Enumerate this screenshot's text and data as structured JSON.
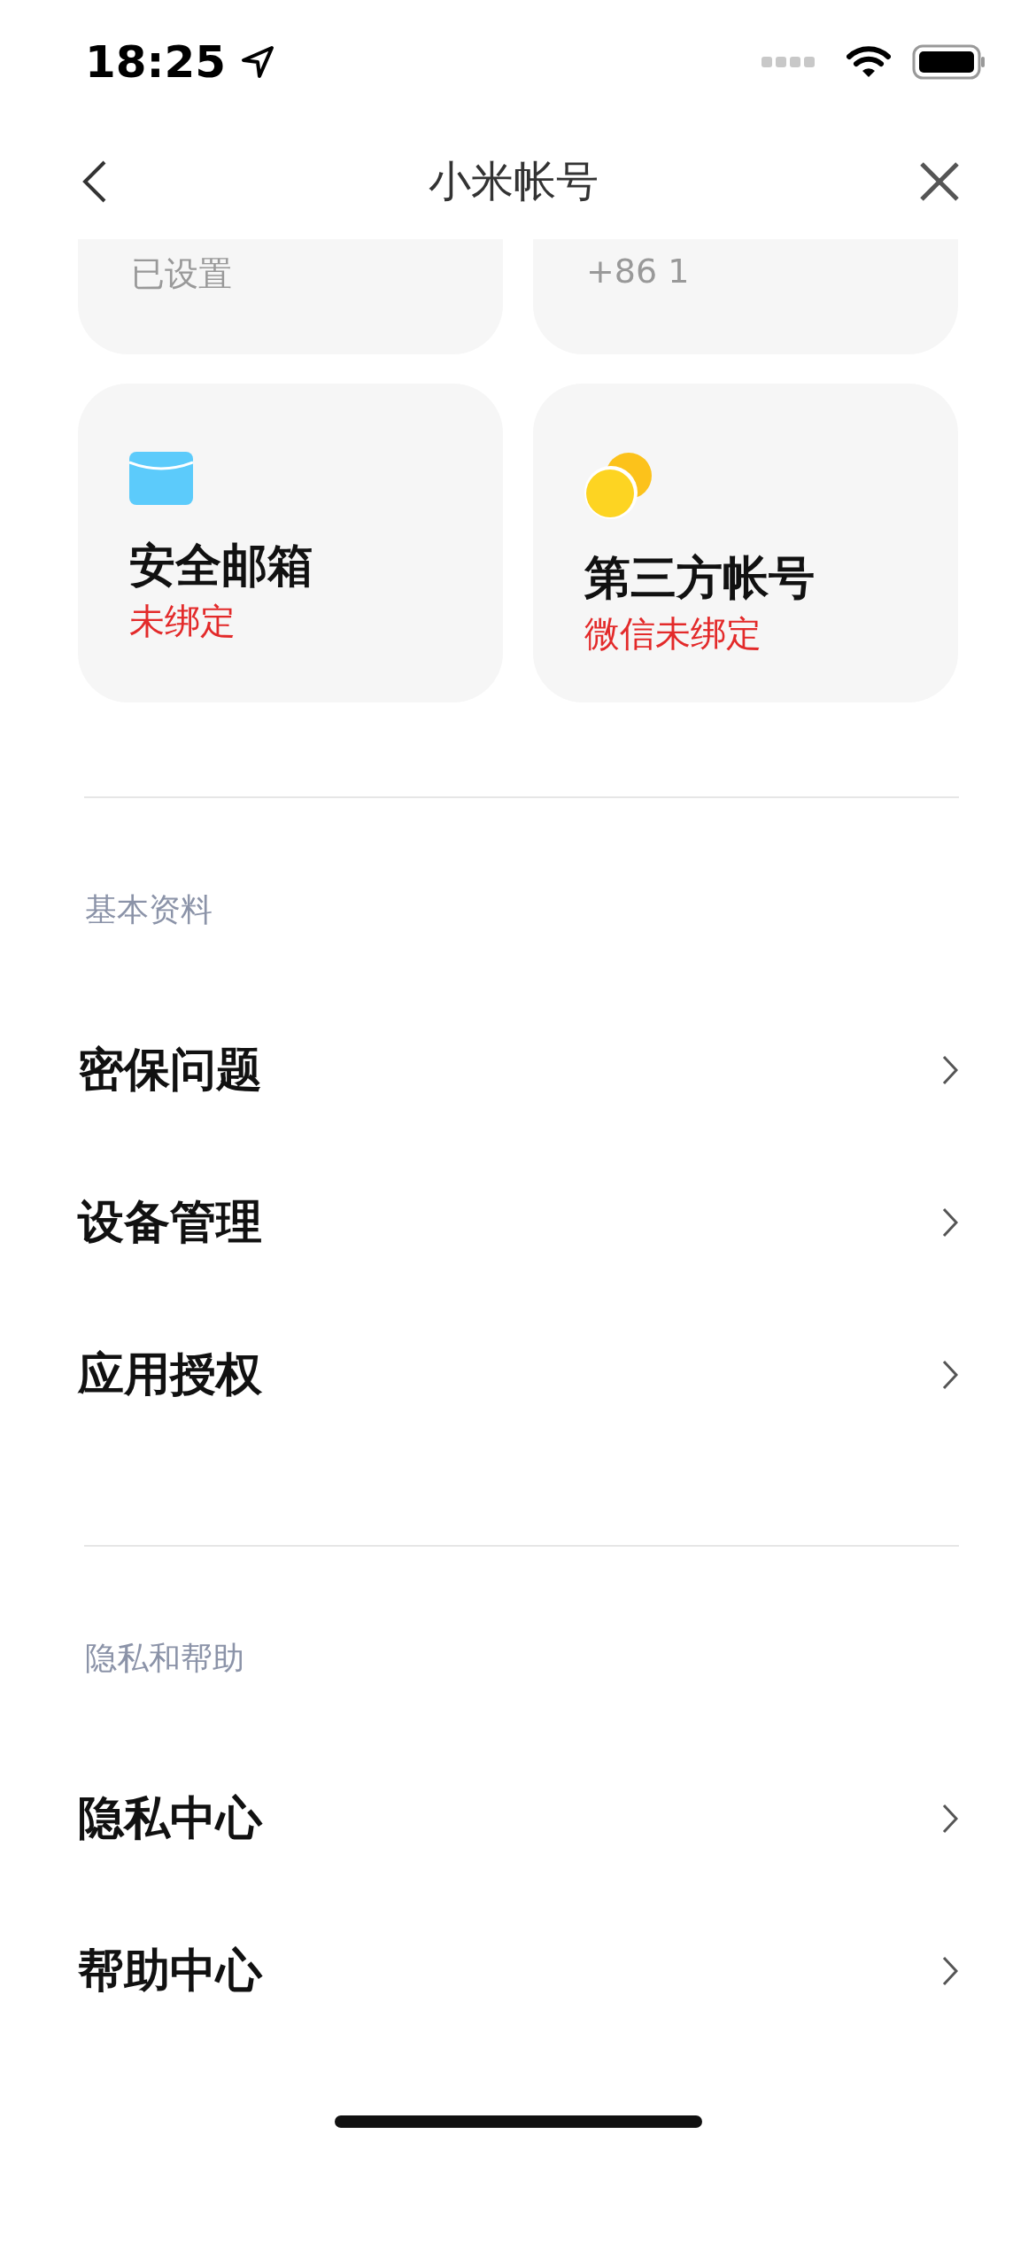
{
  "status_bar": {
    "time": "18:25"
  },
  "nav": {
    "title": "小米帐号"
  },
  "cards": [
    {
      "kind": "partial",
      "subtitle": "已设置",
      "warning": false
    },
    {
      "kind": "partial",
      "subtitle": "+86 1",
      "warning": false
    },
    {
      "kind": "mail",
      "title": "安全邮箱",
      "subtitle": "未绑定",
      "warning": true
    },
    {
      "kind": "coins",
      "title": "第三方帐号",
      "subtitle": "微信未绑定",
      "warning": true
    }
  ],
  "sections": [
    {
      "header": "基本资料",
      "items": [
        {
          "label": "密保问题"
        },
        {
          "label": "设备管理"
        },
        {
          "label": "应用授权"
        }
      ]
    },
    {
      "header": "隐私和帮助",
      "items": [
        {
          "label": "隐私中心"
        },
        {
          "label": "帮助中心"
        }
      ]
    }
  ]
}
